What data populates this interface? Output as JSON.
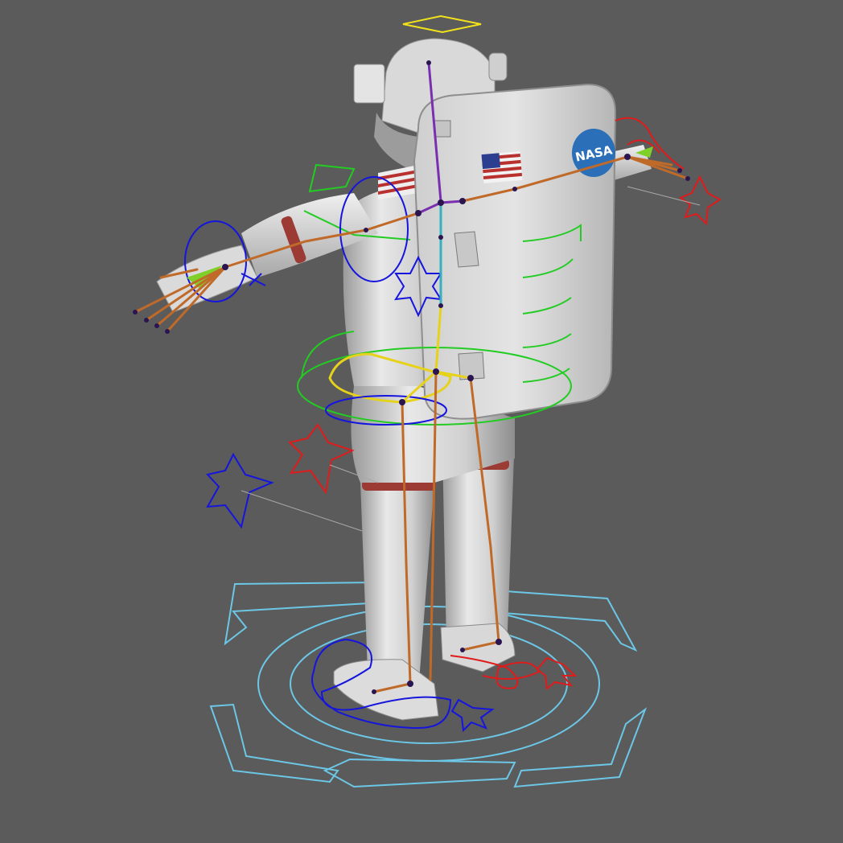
{
  "viewport": {
    "background": "#5b5b5b"
  },
  "model": {
    "suit_light": "#e6e6e6",
    "suit_mid": "#bdbdbd",
    "suit_dark": "#8c8c8c",
    "band_color": "#9c3a34"
  },
  "patch": {
    "text": "NASA",
    "color": "#2a6fb8"
  },
  "flag": {
    "stripe_red": "#b8312f",
    "canton_blue": "#2c3e8f"
  },
  "rig": {
    "root_control_color": "#6cc7e6",
    "left_control_color": "#1515dd",
    "right_control_color": "#e01b1b",
    "spine_control_color": "#22cc22",
    "hip_control_color": "#e6d21a",
    "head_control_color": "#f2e21a",
    "bone_color": "#c06a2a",
    "spine_bone_color": "#7a2fb0",
    "joint_color": "#2a1550",
    "finger_control_color": "#7fd12a"
  }
}
